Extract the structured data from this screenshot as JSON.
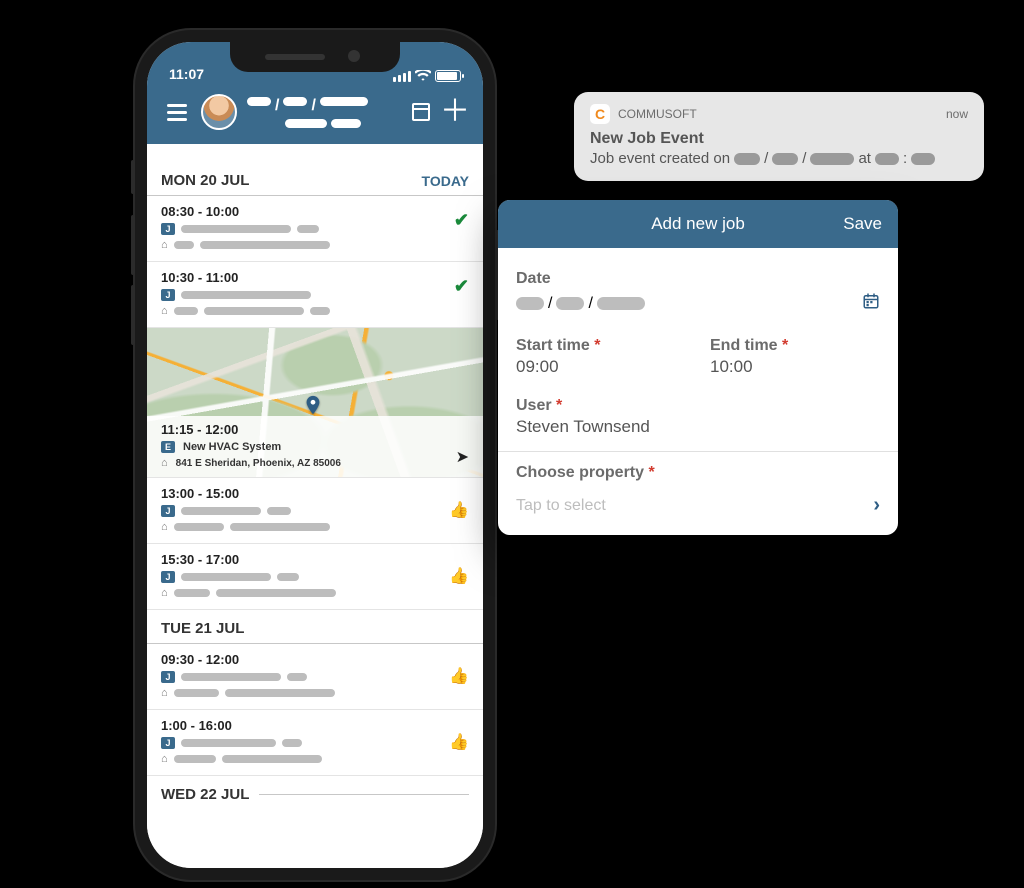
{
  "status_bar": {
    "time": "11:07"
  },
  "header": {
    "today_label": "TODAY"
  },
  "days": [
    {
      "label": "MON 20 JUL"
    },
    {
      "label": "TUE 21 JUL"
    },
    {
      "label": "WED 22 JUL"
    }
  ],
  "events": {
    "d0e0": {
      "time": "08:30 - 10:00"
    },
    "d0e1": {
      "time": "10:30 - 11:00"
    },
    "d0e2": {
      "time": "11:15 - 12:00",
      "title": "New HVAC System",
      "address": "841 E Sheridan, Phoenix, AZ 85006"
    },
    "d0e3": {
      "time": "13:00 - 15:00"
    },
    "d0e4": {
      "time": "15:30 - 17:00"
    },
    "d1e0": {
      "time": "09:30 - 12:00"
    },
    "d1e1": {
      "time": "1:00 - 16:00"
    }
  },
  "notification": {
    "app": "COMMUSOFT",
    "when": "now",
    "title": "New Job Event",
    "body_prefix": "Job event created on",
    "body_at": "at",
    "colon": ":"
  },
  "panel": {
    "title": "Add new job",
    "save": "Save",
    "date_label": "Date",
    "start_label": "Start time",
    "end_label": "End time",
    "start_value": "09:00",
    "end_value": "10:00",
    "user_label": "User",
    "user_value": "Steven Townsend",
    "property_label": "Choose property",
    "property_placeholder": "Tap to select"
  },
  "glyph": {
    "slash": "/"
  }
}
